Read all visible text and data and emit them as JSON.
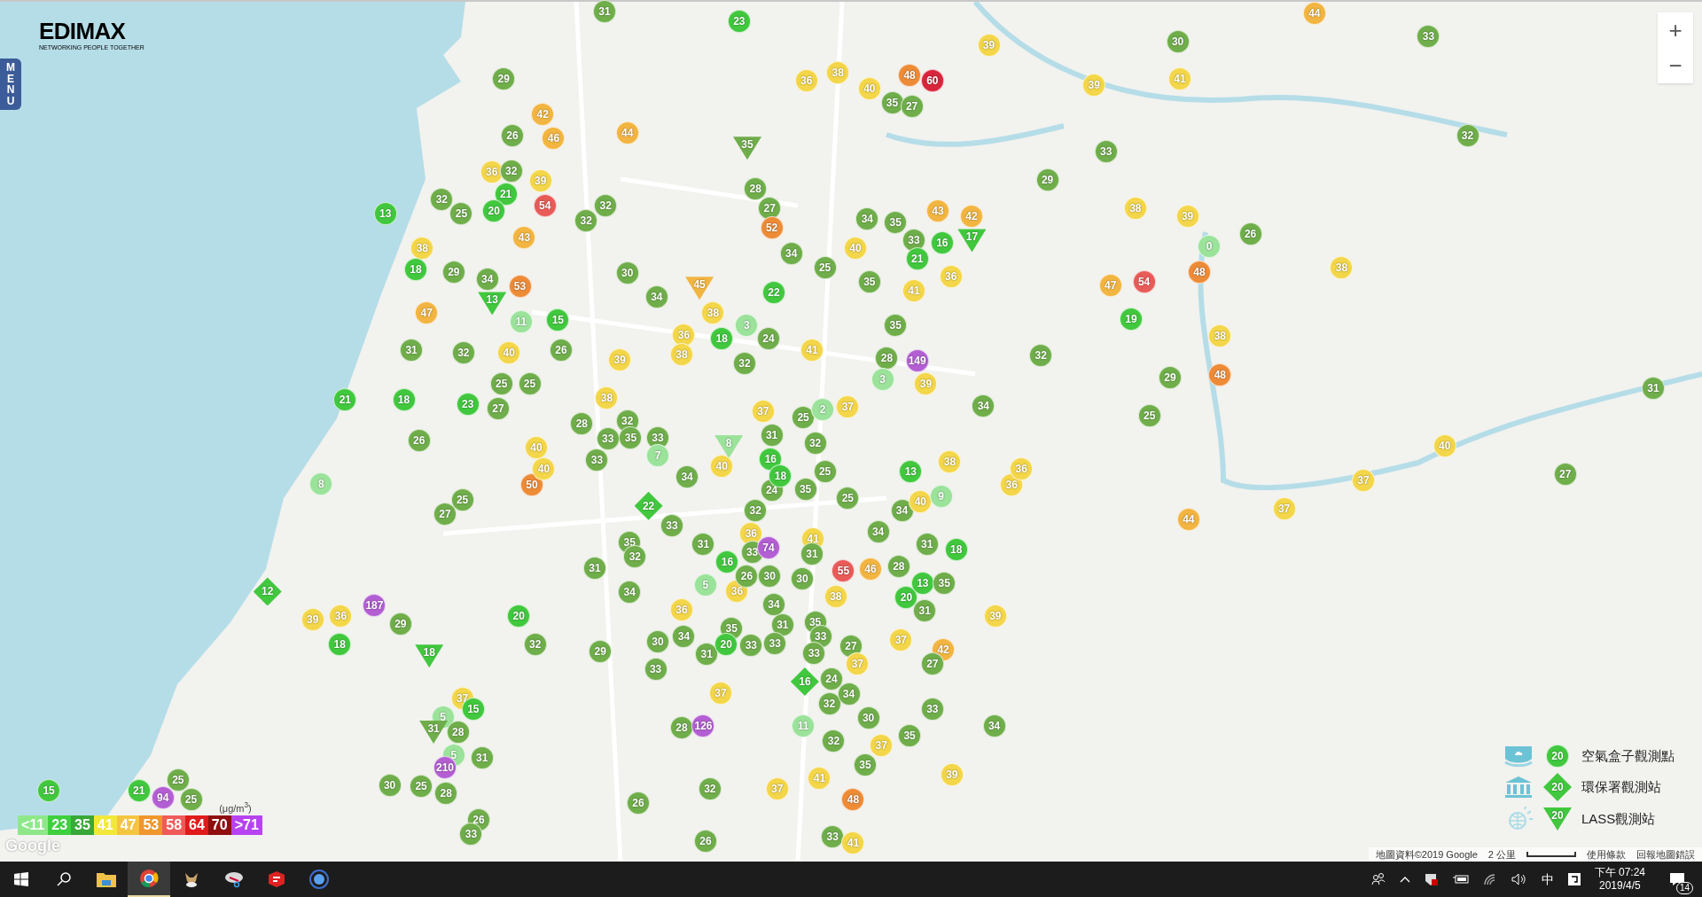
{
  "logo": {
    "name": "EDIMAX",
    "tagline": "NETWORKING PEOPLE TOGETHER"
  },
  "menu_tab": {
    "label": "MENU"
  },
  "zoom_controls": [
    "+",
    "−"
  ],
  "markers": [
    {
      "value": "31",
      "kind": "circle",
      "color": "#6fae4a"
    },
    {
      "value": "23",
      "kind": "circle",
      "color": "#41c83e"
    },
    {
      "value": "44",
      "kind": "circle",
      "color": "#f2b541"
    },
    {
      "value": "39",
      "kind": "circle",
      "color": "#f3d649"
    },
    {
      "value": "30",
      "kind": "circle",
      "color": "#6fae4a"
    },
    {
      "value": "33",
      "kind": "circle",
      "color": "#6fae4a"
    },
    {
      "value": "29",
      "kind": "circle",
      "color": "#6fae4a"
    },
    {
      "value": "36",
      "kind": "circle",
      "color": "#f3d649"
    },
    {
      "value": "38",
      "kind": "circle",
      "color": "#f3d649"
    },
    {
      "value": "40",
      "kind": "circle",
      "color": "#f3d649"
    },
    {
      "value": "48",
      "kind": "circle",
      "color": "#ee8b37"
    },
    {
      "value": "60",
      "kind": "circle",
      "color": "#d9253b"
    },
    {
      "value": "39",
      "kind": "circle",
      "color": "#f3d649"
    },
    {
      "value": "41",
      "kind": "circle",
      "color": "#f3d649"
    },
    {
      "value": "35",
      "kind": "circle",
      "color": "#6fae4a"
    },
    {
      "value": "27",
      "kind": "circle",
      "color": "#6fae4a"
    },
    {
      "value": "42",
      "kind": "circle",
      "color": "#f2b541"
    },
    {
      "value": "26",
      "kind": "circle",
      "color": "#6fae4a"
    },
    {
      "value": "46",
      "kind": "circle",
      "color": "#f2b541"
    },
    {
      "value": "44",
      "kind": "circle",
      "color": "#f2b541"
    },
    {
      "value": "32",
      "kind": "circle",
      "color": "#6fae4a"
    },
    {
      "value": "35",
      "kind": "triangle",
      "color": "#6fae4a"
    },
    {
      "value": "33",
      "kind": "circle",
      "color": "#6fae4a"
    },
    {
      "value": "36",
      "kind": "circle",
      "color": "#f3d649"
    },
    {
      "value": "32",
      "kind": "circle",
      "color": "#6fae4a"
    },
    {
      "value": "39",
      "kind": "circle",
      "color": "#f3d649"
    },
    {
      "value": "29",
      "kind": "circle",
      "color": "#6fae4a"
    },
    {
      "value": "32",
      "kind": "circle",
      "color": "#6fae4a"
    },
    {
      "value": "21",
      "kind": "circle",
      "color": "#41c83e"
    },
    {
      "value": "28",
      "kind": "circle",
      "color": "#6fae4a"
    },
    {
      "value": "13",
      "kind": "circle",
      "color": "#41c83e"
    },
    {
      "value": "25",
      "kind": "circle",
      "color": "#6fae4a"
    },
    {
      "value": "20",
      "kind": "circle",
      "color": "#41c83e"
    },
    {
      "value": "54",
      "kind": "circle",
      "color": "#e85b58"
    },
    {
      "value": "32",
      "kind": "circle",
      "color": "#6fae4a"
    },
    {
      "value": "32",
      "kind": "circle",
      "color": "#6fae4a"
    },
    {
      "value": "27",
      "kind": "circle",
      "color": "#6fae4a"
    },
    {
      "value": "52",
      "kind": "circle",
      "color": "#ee8b37"
    },
    {
      "value": "34",
      "kind": "circle",
      "color": "#6fae4a"
    },
    {
      "value": "35",
      "kind": "circle",
      "color": "#6fae4a"
    },
    {
      "value": "43",
      "kind": "circle",
      "color": "#f2b541"
    },
    {
      "value": "42",
      "kind": "circle",
      "color": "#f2b541"
    },
    {
      "value": "38",
      "kind": "circle",
      "color": "#f3d649"
    },
    {
      "value": "39",
      "kind": "circle",
      "color": "#f3d649"
    },
    {
      "value": "26",
      "kind": "circle",
      "color": "#6fae4a"
    },
    {
      "value": "38",
      "kind": "circle",
      "color": "#f3d649"
    },
    {
      "value": "43",
      "kind": "circle",
      "color": "#f2b541"
    },
    {
      "value": "34",
      "kind": "circle",
      "color": "#6fae4a"
    },
    {
      "value": "40",
      "kind": "circle",
      "color": "#f3d649"
    },
    {
      "value": "33",
      "kind": "circle",
      "color": "#6fae4a"
    },
    {
      "value": "16",
      "kind": "circle",
      "color": "#41c83e"
    },
    {
      "value": "17",
      "kind": "triangle",
      "color": "#41c83e"
    },
    {
      "value": "0",
      "kind": "circle",
      "color": "#9be29a"
    },
    {
      "value": "21",
      "kind": "circle",
      "color": "#41c83e"
    },
    {
      "value": "18",
      "kind": "circle",
      "color": "#41c83e"
    },
    {
      "value": "29",
      "kind": "circle",
      "color": "#6fae4a"
    },
    {
      "value": "34",
      "kind": "circle",
      "color": "#6fae4a"
    },
    {
      "value": "53",
      "kind": "circle",
      "color": "#ee8b37"
    },
    {
      "value": "30",
      "kind": "circle",
      "color": "#6fae4a"
    },
    {
      "value": "34",
      "kind": "circle",
      "color": "#6fae4a"
    },
    {
      "value": "45",
      "kind": "triangle",
      "color": "#f2b541"
    },
    {
      "value": "22",
      "kind": "circle",
      "color": "#41c83e"
    },
    {
      "value": "25",
      "kind": "circle",
      "color": "#6fae4a"
    },
    {
      "value": "35",
      "kind": "circle",
      "color": "#6fae4a"
    },
    {
      "value": "41",
      "kind": "circle",
      "color": "#f3d649"
    },
    {
      "value": "36",
      "kind": "circle",
      "color": "#f3d649"
    },
    {
      "value": "47",
      "kind": "circle",
      "color": "#f2b541"
    },
    {
      "value": "54",
      "kind": "circle",
      "color": "#e85b58"
    },
    {
      "value": "48",
      "kind": "circle",
      "color": "#ee8b37"
    },
    {
      "value": "38",
      "kind": "circle",
      "color": "#f3d649"
    },
    {
      "value": "13",
      "kind": "triangle",
      "color": "#41c83e"
    },
    {
      "value": "47",
      "kind": "circle",
      "color": "#f2b541"
    },
    {
      "value": "38",
      "kind": "circle",
      "color": "#f3d649"
    },
    {
      "value": "11",
      "kind": "circle",
      "color": "#9be29a"
    },
    {
      "value": "15",
      "kind": "circle",
      "color": "#41c83e"
    },
    {
      "value": "3",
      "kind": "circle",
      "color": "#9be29a"
    },
    {
      "value": "35",
      "kind": "circle",
      "color": "#6fae4a"
    },
    {
      "value": "19",
      "kind": "circle",
      "color": "#41c83e"
    },
    {
      "value": "36",
      "kind": "circle",
      "color": "#f3d649"
    },
    {
      "value": "18",
      "kind": "circle",
      "color": "#41c83e"
    },
    {
      "value": "24",
      "kind": "circle",
      "color": "#6fae4a"
    },
    {
      "value": "38",
      "kind": "circle",
      "color": "#f3d649"
    },
    {
      "value": "31",
      "kind": "circle",
      "color": "#6fae4a"
    },
    {
      "value": "32",
      "kind": "circle",
      "color": "#6fae4a"
    },
    {
      "value": "40",
      "kind": "circle",
      "color": "#f3d649"
    },
    {
      "value": "26",
      "kind": "circle",
      "color": "#6fae4a"
    },
    {
      "value": "39",
      "kind": "circle",
      "color": "#f3d649"
    },
    {
      "value": "38",
      "kind": "circle",
      "color": "#f3d649"
    },
    {
      "value": "32",
      "kind": "circle",
      "color": "#6fae4a"
    },
    {
      "value": "41",
      "kind": "circle",
      "color": "#f3d649"
    },
    {
      "value": "28",
      "kind": "circle",
      "color": "#6fae4a"
    },
    {
      "value": "149",
      "kind": "circle",
      "color": "#b35fd3"
    },
    {
      "value": "32",
      "kind": "circle",
      "color": "#6fae4a"
    },
    {
      "value": "25",
      "kind": "circle",
      "color": "#6fae4a"
    },
    {
      "value": "25",
      "kind": "circle",
      "color": "#6fae4a"
    },
    {
      "value": "3",
      "kind": "circle",
      "color": "#9be29a"
    },
    {
      "value": "39",
      "kind": "circle",
      "color": "#f3d649"
    },
    {
      "value": "29",
      "kind": "circle",
      "color": "#6fae4a"
    },
    {
      "value": "48",
      "kind": "circle",
      "color": "#ee8b37"
    },
    {
      "value": "31",
      "kind": "circle",
      "color": "#6fae4a"
    },
    {
      "value": "21",
      "kind": "circle",
      "color": "#41c83e"
    },
    {
      "value": "18",
      "kind": "circle",
      "color": "#41c83e"
    },
    {
      "value": "23",
      "kind": "circle",
      "color": "#41c83e"
    },
    {
      "value": "27",
      "kind": "circle",
      "color": "#6fae4a"
    },
    {
      "value": "28",
      "kind": "circle",
      "color": "#6fae4a"
    },
    {
      "value": "38",
      "kind": "circle",
      "color": "#f3d649"
    },
    {
      "value": "32",
      "kind": "circle",
      "color": "#6fae4a"
    },
    {
      "value": "37",
      "kind": "circle",
      "color": "#f3d649"
    },
    {
      "value": "25",
      "kind": "circle",
      "color": "#6fae4a"
    },
    {
      "value": "2",
      "kind": "circle",
      "color": "#9be29a"
    },
    {
      "value": "37",
      "kind": "circle",
      "color": "#f3d649"
    },
    {
      "value": "34",
      "kind": "circle",
      "color": "#6fae4a"
    },
    {
      "value": "25",
      "kind": "circle",
      "color": "#6fae4a"
    },
    {
      "value": "26",
      "kind": "circle",
      "color": "#6fae4a"
    },
    {
      "value": "40",
      "kind": "circle",
      "color": "#f3d649"
    },
    {
      "value": "33",
      "kind": "circle",
      "color": "#6fae4a"
    },
    {
      "value": "35",
      "kind": "circle",
      "color": "#6fae4a"
    },
    {
      "value": "33",
      "kind": "circle",
      "color": "#6fae4a"
    },
    {
      "value": "8",
      "kind": "triangle",
      "color": "#9be29a"
    },
    {
      "value": "31",
      "kind": "circle",
      "color": "#6fae4a"
    },
    {
      "value": "32",
      "kind": "circle",
      "color": "#6fae4a"
    },
    {
      "value": "40",
      "kind": "circle",
      "color": "#f3d649"
    },
    {
      "value": "8",
      "kind": "circle",
      "color": "#9be29a"
    },
    {
      "value": "50",
      "kind": "circle",
      "color": "#ee8b37"
    },
    {
      "value": "40",
      "kind": "circle",
      "color": "#f3d649"
    },
    {
      "value": "33",
      "kind": "circle",
      "color": "#6fae4a"
    },
    {
      "value": "7",
      "kind": "circle",
      "color": "#9be29a"
    },
    {
      "value": "34",
      "kind": "circle",
      "color": "#6fae4a"
    },
    {
      "value": "40",
      "kind": "circle",
      "color": "#f3d649"
    },
    {
      "value": "16",
      "kind": "circle",
      "color": "#41c83e"
    },
    {
      "value": "24",
      "kind": "circle",
      "color": "#6fae4a"
    },
    {
      "value": "18",
      "kind": "circle",
      "color": "#41c83e"
    },
    {
      "value": "35",
      "kind": "circle",
      "color": "#6fae4a"
    },
    {
      "value": "25",
      "kind": "circle",
      "color": "#6fae4a"
    },
    {
      "value": "13",
      "kind": "circle",
      "color": "#41c83e"
    },
    {
      "value": "38",
      "kind": "circle",
      "color": "#f3d649"
    },
    {
      "value": "36",
      "kind": "circle",
      "color": "#f3d649"
    },
    {
      "value": "36",
      "kind": "circle",
      "color": "#f3d649"
    },
    {
      "value": "37",
      "kind": "circle",
      "color": "#f3d649"
    },
    {
      "value": "27",
      "kind": "circle",
      "color": "#6fae4a"
    },
    {
      "value": "27",
      "kind": "circle",
      "color": "#6fae4a"
    },
    {
      "value": "25",
      "kind": "circle",
      "color": "#6fae4a"
    },
    {
      "value": "22",
      "kind": "diamond",
      "color": "#41c83e"
    },
    {
      "value": "32",
      "kind": "circle",
      "color": "#6fae4a"
    },
    {
      "value": "25",
      "kind": "circle",
      "color": "#6fae4a"
    },
    {
      "value": "34",
      "kind": "circle",
      "color": "#6fae4a"
    },
    {
      "value": "40",
      "kind": "circle",
      "color": "#f3d649"
    },
    {
      "value": "9",
      "kind": "circle",
      "color": "#9be29a"
    },
    {
      "value": "44",
      "kind": "circle",
      "color": "#f2b541"
    },
    {
      "value": "37",
      "kind": "circle",
      "color": "#f3d649"
    },
    {
      "value": "12",
      "kind": "diamond",
      "color": "#41c83e"
    },
    {
      "value": "39",
      "kind": "circle",
      "color": "#f3d649"
    },
    {
      "value": "36",
      "kind": "circle",
      "color": "#f3d649"
    },
    {
      "value": "187",
      "kind": "circle",
      "color": "#b35fd3"
    },
    {
      "value": "29",
      "kind": "circle",
      "color": "#6fae4a"
    },
    {
      "value": "20",
      "kind": "circle",
      "color": "#41c83e"
    },
    {
      "value": "31",
      "kind": "circle",
      "color": "#6fae4a"
    },
    {
      "value": "35",
      "kind": "circle",
      "color": "#6fae4a"
    },
    {
      "value": "34",
      "kind": "circle",
      "color": "#6fae4a"
    },
    {
      "value": "32",
      "kind": "circle",
      "color": "#6fae4a"
    },
    {
      "value": "33",
      "kind": "circle",
      "color": "#6fae4a"
    },
    {
      "value": "36",
      "kind": "circle",
      "color": "#f3d649"
    },
    {
      "value": "31",
      "kind": "circle",
      "color": "#6fae4a"
    },
    {
      "value": "5",
      "kind": "circle",
      "color": "#9be29a"
    },
    {
      "value": "16",
      "kind": "circle",
      "color": "#41c83e"
    },
    {
      "value": "35",
      "kind": "circle",
      "color": "#6fae4a"
    },
    {
      "value": "36",
      "kind": "circle",
      "color": "#f3d649"
    },
    {
      "value": "36",
      "kind": "circle",
      "color": "#f3d649"
    },
    {
      "value": "33",
      "kind": "circle",
      "color": "#6fae4a"
    },
    {
      "value": "26",
      "kind": "circle",
      "color": "#6fae4a"
    },
    {
      "value": "74",
      "kind": "circle",
      "color": "#b35fd3"
    },
    {
      "value": "30",
      "kind": "circle",
      "color": "#6fae4a"
    },
    {
      "value": "34",
      "kind": "circle",
      "color": "#6fae4a"
    },
    {
      "value": "31",
      "kind": "circle",
      "color": "#6fae4a"
    },
    {
      "value": "30",
      "kind": "circle",
      "color": "#6fae4a"
    },
    {
      "value": "41",
      "kind": "circle",
      "color": "#f3d649"
    },
    {
      "value": "31",
      "kind": "circle",
      "color": "#6fae4a"
    },
    {
      "value": "35",
      "kind": "circle",
      "color": "#6fae4a"
    },
    {
      "value": "38",
      "kind": "circle",
      "color": "#f3d649"
    },
    {
      "value": "55",
      "kind": "circle",
      "color": "#e85b58"
    },
    {
      "value": "46",
      "kind": "circle",
      "color": "#f2b541"
    },
    {
      "value": "34",
      "kind": "circle",
      "color": "#6fae4a"
    },
    {
      "value": "28",
      "kind": "circle",
      "color": "#6fae4a"
    },
    {
      "value": "20",
      "kind": "circle",
      "color": "#41c83e"
    },
    {
      "value": "31",
      "kind": "circle",
      "color": "#6fae4a"
    },
    {
      "value": "13",
      "kind": "circle",
      "color": "#41c83e"
    },
    {
      "value": "31",
      "kind": "circle",
      "color": "#6fae4a"
    },
    {
      "value": "35",
      "kind": "circle",
      "color": "#6fae4a"
    },
    {
      "value": "18",
      "kind": "circle",
      "color": "#41c83e"
    },
    {
      "value": "39",
      "kind": "circle",
      "color": "#f3d649"
    },
    {
      "value": "18",
      "kind": "circle",
      "color": "#41c83e"
    },
    {
      "value": "18",
      "kind": "triangle",
      "color": "#41c83e"
    },
    {
      "value": "32",
      "kind": "circle",
      "color": "#6fae4a"
    },
    {
      "value": "29",
      "kind": "circle",
      "color": "#6fae4a"
    },
    {
      "value": "30",
      "kind": "circle",
      "color": "#6fae4a"
    },
    {
      "value": "34",
      "kind": "circle",
      "color": "#6fae4a"
    },
    {
      "value": "31",
      "kind": "circle",
      "color": "#6fae4a"
    },
    {
      "value": "20",
      "kind": "circle",
      "color": "#41c83e"
    },
    {
      "value": "33",
      "kind": "circle",
      "color": "#6fae4a"
    },
    {
      "value": "33",
      "kind": "circle",
      "color": "#6fae4a"
    },
    {
      "value": "33",
      "kind": "circle",
      "color": "#6fae4a"
    },
    {
      "value": "33",
      "kind": "circle",
      "color": "#6fae4a"
    },
    {
      "value": "27",
      "kind": "circle",
      "color": "#6fae4a"
    },
    {
      "value": "37",
      "kind": "circle",
      "color": "#f3d649"
    },
    {
      "value": "42",
      "kind": "circle",
      "color": "#f2b541"
    },
    {
      "value": "33",
      "kind": "circle",
      "color": "#6fae4a"
    },
    {
      "value": "37",
      "kind": "circle",
      "color": "#f3d649"
    },
    {
      "value": "27",
      "kind": "circle",
      "color": "#6fae4a"
    },
    {
      "value": "16",
      "kind": "diamond",
      "color": "#41c83e"
    },
    {
      "value": "24",
      "kind": "circle",
      "color": "#6fae4a"
    },
    {
      "value": "5",
      "kind": "circle",
      "color": "#9be29a"
    },
    {
      "value": "37",
      "kind": "circle",
      "color": "#f3d649"
    },
    {
      "value": "15",
      "kind": "circle",
      "color": "#41c83e"
    },
    {
      "value": "37",
      "kind": "circle",
      "color": "#f3d649"
    },
    {
      "value": "32",
      "kind": "circle",
      "color": "#6fae4a"
    },
    {
      "value": "34",
      "kind": "circle",
      "color": "#6fae4a"
    },
    {
      "value": "30",
      "kind": "circle",
      "color": "#6fae4a"
    },
    {
      "value": "33",
      "kind": "circle",
      "color": "#6fae4a"
    },
    {
      "value": "31",
      "kind": "triangle",
      "color": "#6fae4a"
    },
    {
      "value": "28",
      "kind": "circle",
      "color": "#6fae4a"
    },
    {
      "value": "28",
      "kind": "circle",
      "color": "#6fae4a"
    },
    {
      "value": "126",
      "kind": "circle",
      "color": "#b35fd3"
    },
    {
      "value": "11",
      "kind": "circle",
      "color": "#9be29a"
    },
    {
      "value": "32",
      "kind": "circle",
      "color": "#6fae4a"
    },
    {
      "value": "37",
      "kind": "circle",
      "color": "#f3d649"
    },
    {
      "value": "35",
      "kind": "circle",
      "color": "#6fae4a"
    },
    {
      "value": "34",
      "kind": "circle",
      "color": "#6fae4a"
    },
    {
      "value": "5",
      "kind": "circle",
      "color": "#9be29a"
    },
    {
      "value": "31",
      "kind": "circle",
      "color": "#6fae4a"
    },
    {
      "value": "35",
      "kind": "circle",
      "color": "#6fae4a"
    },
    {
      "value": "15",
      "kind": "circle",
      "color": "#41c83e"
    },
    {
      "value": "21",
      "kind": "circle",
      "color": "#41c83e"
    },
    {
      "value": "94",
      "kind": "circle",
      "color": "#b35fd3"
    },
    {
      "value": "25",
      "kind": "circle",
      "color": "#6fae4a"
    },
    {
      "value": "25",
      "kind": "circle",
      "color": "#6fae4a"
    },
    {
      "value": "30",
      "kind": "circle",
      "color": "#6fae4a"
    },
    {
      "value": "25",
      "kind": "circle",
      "color": "#6fae4a"
    },
    {
      "value": "210",
      "kind": "circle",
      "color": "#b35fd3"
    },
    {
      "value": "28",
      "kind": "circle",
      "color": "#6fae4a"
    },
    {
      "value": "26",
      "kind": "circle",
      "color": "#6fae4a"
    },
    {
      "value": "32",
      "kind": "circle",
      "color": "#6fae4a"
    },
    {
      "value": "37",
      "kind": "circle",
      "color": "#f3d649"
    },
    {
      "value": "41",
      "kind": "circle",
      "color": "#f3d649"
    },
    {
      "value": "48",
      "kind": "circle",
      "color": "#ee8b37"
    },
    {
      "value": "39",
      "kind": "circle",
      "color": "#f3d649"
    },
    {
      "value": "26",
      "kind": "circle",
      "color": "#6fae4a"
    },
    {
      "value": "33",
      "kind": "circle",
      "color": "#6fae4a"
    },
    {
      "value": "26",
      "kind": "circle",
      "color": "#6fae4a"
    },
    {
      "value": "33",
      "kind": "circle",
      "color": "#6fae4a"
    },
    {
      "value": "41",
      "kind": "circle",
      "color": "#f3d649"
    }
  ],
  "scale_legend": {
    "unit": "(μg/m$^{3}$)",
    "bands": [
      {
        "label": "<11",
        "color": "#8ee88a"
      },
      {
        "label": "23",
        "color": "#3fcf3f"
      },
      {
        "label": "35",
        "color": "#38a838"
      },
      {
        "label": "41",
        "color": "#f2e83a"
      },
      {
        "label": "47",
        "color": "#f5c542"
      },
      {
        "label": "53",
        "color": "#f0962e"
      },
      {
        "label": "58",
        "color": "#f05a5a"
      },
      {
        "label": "64",
        "color": "#e01b1b"
      },
      {
        "label": "70",
        "color": "#8f0f0f"
      },
      {
        "label": ">71",
        "color": "#b743f0"
      }
    ]
  },
  "station_legend": [
    {
      "kind": "circle",
      "value": "20",
      "label": "空氣盒子觀測點"
    },
    {
      "kind": "diamond",
      "value": "20",
      "label": "環保署觀測站"
    },
    {
      "kind": "triangle",
      "value": "20",
      "label": "LASS觀測站"
    }
  ],
  "google_logo": "Google",
  "map_footer": {
    "data": "地圖資料©2019 Google",
    "scale": "2 公里",
    "terms": "使用條款",
    "report": "回報地圖錯誤"
  },
  "taskbar": {
    "ime": "中",
    "time": "下午 07:24",
    "date": "2019/4/5",
    "notifications": "14"
  }
}
